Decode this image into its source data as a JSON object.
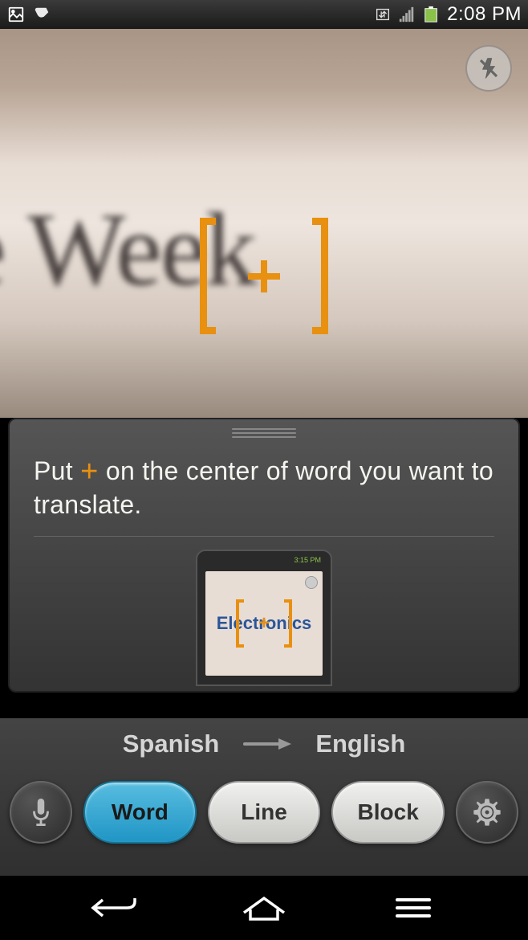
{
  "status_bar": {
    "time": "2:08 PM"
  },
  "viewfinder": {
    "background_text": "e Week"
  },
  "instruction": {
    "text_before": "Put",
    "text_after": "on the center of word you want to translate.",
    "example_word": "Electronics",
    "phone_status": "3:15 PM"
  },
  "languages": {
    "source": "Spanish",
    "target": "English"
  },
  "modes": {
    "word": "Word",
    "line": "Line",
    "block": "Block"
  }
}
